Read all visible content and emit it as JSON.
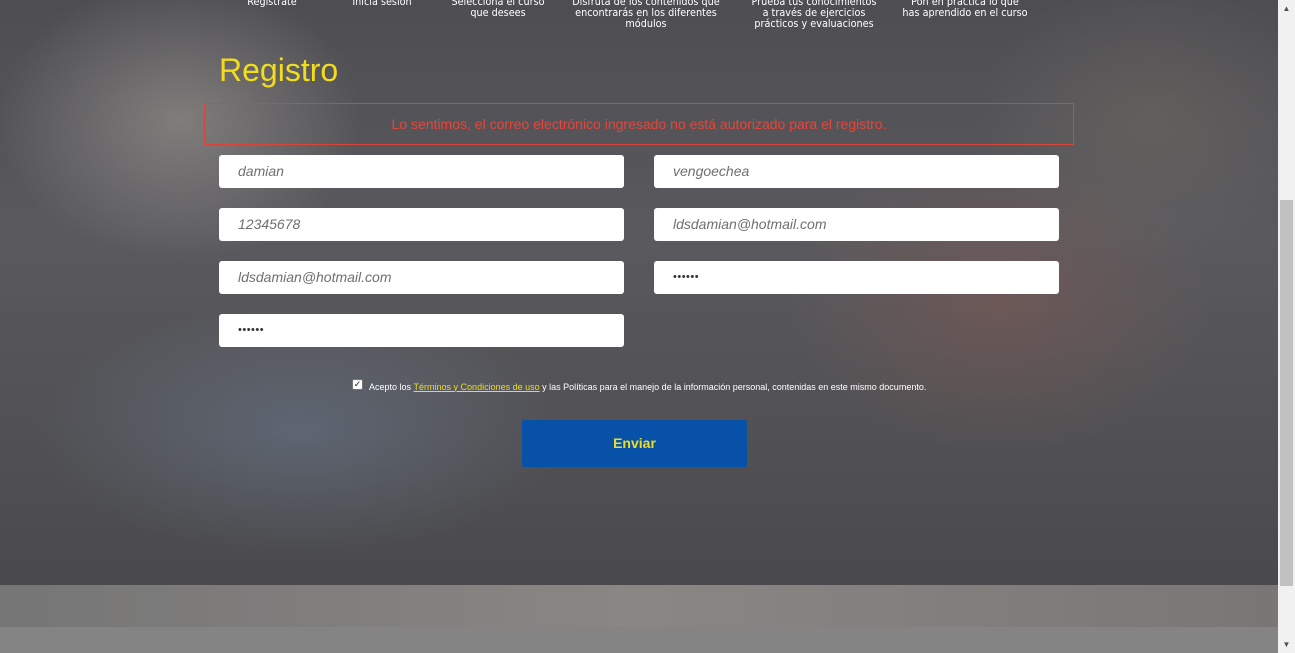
{
  "steps": [
    {
      "line1": "Regístrate",
      "line2": "",
      "line3": ""
    },
    {
      "line1": "Inicia sesión",
      "line2": "",
      "line3": ""
    },
    {
      "line1": "Selecciona el curso",
      "line2": "que desees",
      "line3": ""
    },
    {
      "line1": "Disfruta de los contenidos que",
      "line2": "encontrarás en los diferentes módulos",
      "line3": ""
    },
    {
      "line1": "Prueba tus conocimientos",
      "line2": "a través de ejercicios",
      "line3": "prácticos y evaluaciones"
    },
    {
      "line1": "Pon en práctica lo que",
      "line2": "has aprendido en el curso",
      "line3": ""
    }
  ],
  "form": {
    "title": "Registro",
    "error": "Lo sentimos, el correo electrónico ingresado no está autorizado para el registro.",
    "fields": {
      "first_name": "damian",
      "last_name": "vengoechea",
      "document": "12345678",
      "email": "ldsdamian@hotmail.com",
      "email_confirm": "ldsdamian@hotmail.com",
      "password": "••••••",
      "password_confirm": "••••••"
    },
    "terms": {
      "checked": true,
      "prefix": "Acepto los",
      "link": "Términos y Condiciones de uso",
      "suffix": "y las Políticas para el manejo de la información personal, contenidas en este mismo documento."
    },
    "submit": "Enviar"
  },
  "colors": {
    "title": "#f2dd1c",
    "error": "#e8443a",
    "button": "#0752a8",
    "button_text": "#f2dd1c"
  },
  "icons": {
    "scroll_up": "triangle-up",
    "scroll_down": "triangle-down",
    "checkbox": "check-mark"
  }
}
